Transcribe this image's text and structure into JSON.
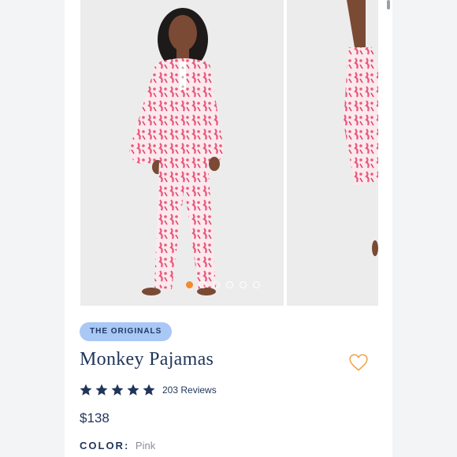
{
  "product": {
    "badge": "THE ORIGINALS",
    "title": "Monkey Pajamas",
    "rating_stars": 5,
    "reviews": "203 Reviews",
    "price": "$138",
    "color_label": "COLOR:",
    "color_value": "Pink"
  },
  "gallery": {
    "slide_count": 6,
    "active_index": 0
  },
  "colors": {
    "accent_dot": "#f28a2e",
    "navy": "#1f3559",
    "badge_bg": "#a9c8f5",
    "pajama_pink": "#e85a7c",
    "heart": "#f0a24a"
  }
}
